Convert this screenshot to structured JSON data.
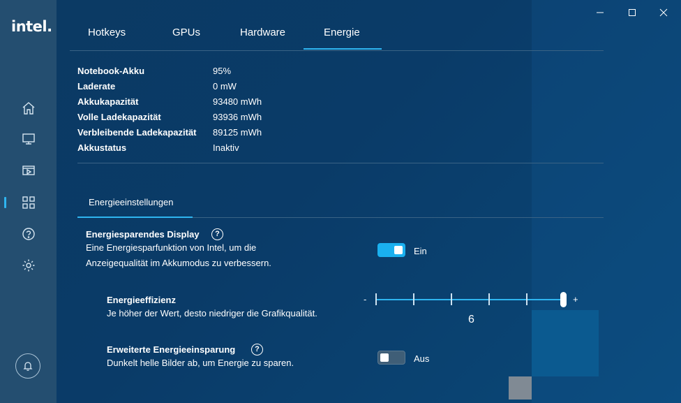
{
  "brand": {
    "logo_text": "intel."
  },
  "window_controls": {
    "minimize": "—",
    "maximize": "☐",
    "close": "✕"
  },
  "tabs": [
    {
      "label": "Hotkeys"
    },
    {
      "label": "GPUs"
    },
    {
      "label": "Hardware"
    },
    {
      "label": "Energie",
      "active": true
    }
  ],
  "battery_info": [
    {
      "label": "Notebook-Akku",
      "value": "95%"
    },
    {
      "label": "Laderate",
      "value": "0 mW"
    },
    {
      "label": "Akkukapazität",
      "value": "93480 mWh"
    },
    {
      "label": "Volle Ladekapazität",
      "value": "93936 mWh"
    },
    {
      "label": "Verbleibende Ladekapazität",
      "value": "89125 mWh"
    },
    {
      "label": "Akkustatus",
      "value": "Inaktiv"
    }
  ],
  "section_tab": "Energieeinstellungen",
  "energy_display": {
    "title": "Energiesparendes Display",
    "help": "?",
    "desc_line1": "Eine Energiesparfunktion von Intel, um die",
    "desc_line2": "Anzeigequalität im Akkumodus zu verbessern.",
    "toggle_state": "Ein",
    "enabled": true
  },
  "efficiency": {
    "title": "Energieeffizienz",
    "desc": "Je höher der Wert, desto niedriger die Grafikqualität.",
    "minus": "-",
    "plus": "+",
    "value": "6"
  },
  "extended_saving": {
    "title": "Erweiterte Energieeinsparung",
    "help": "?",
    "desc": "Dunkelt helle Bilder ab, um Energie zu sparen.",
    "toggle_state": "Aus",
    "enabled": false
  },
  "sidebar_icons": [
    "home-icon",
    "display-icon",
    "video-icon",
    "apps-icon",
    "help-icon",
    "settings-icon",
    "bell-icon"
  ],
  "colors": {
    "accent": "#2fb5f0",
    "sidebar": "#244e70",
    "background": "#0b3d66"
  }
}
